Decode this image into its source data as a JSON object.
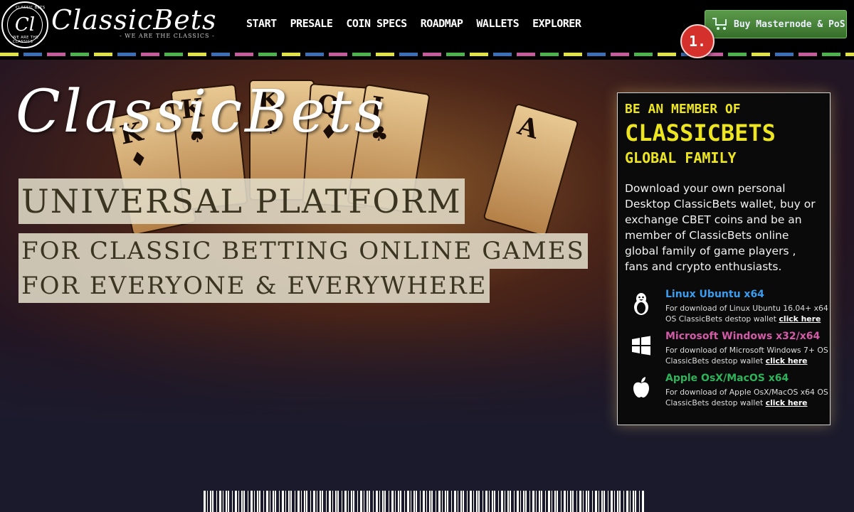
{
  "brand": {
    "seal_monogram": "Cl",
    "seal_top_text": "CLASSIC BETS",
    "seal_bottom_text": "WE ARE THE CLASSICS",
    "wordmark": "ClassicBets",
    "tagline": "- WE ARE THE CLASSICS -"
  },
  "nav": {
    "items": [
      "START",
      "PRESALE",
      "COIN SPECS",
      "ROADMAP",
      "WALLETS",
      "EXPLORER"
    ]
  },
  "header": {
    "buy_button": {
      "label": "Buy Masternode & PoS",
      "icon": "cart-icon"
    },
    "step_badge": "1."
  },
  "stripe_colors": [
    "#dfe242",
    "#3b6fb8",
    "#c45c9c",
    "#4bb24c"
  ],
  "hero": {
    "script_title": "ClassicBets",
    "headline_1": "UNIVERSAL PLATFORM",
    "headline_2": "FOR CLASSIC BETTING ONLINE GAMES",
    "headline_3": "FOR EVERYONE & EVERYWHERE",
    "cards": [
      {
        "letter": "K",
        "suit": "♦"
      },
      {
        "letter": "K",
        "suit": "♠"
      },
      {
        "letter": "K",
        "suit": "♣"
      },
      {
        "letter": "Q",
        "suit": "♦"
      },
      {
        "letter": "J",
        "suit": "♣"
      },
      {
        "letter": "A",
        "suit": ""
      }
    ]
  },
  "panel": {
    "heading_line_1": "BE AN MEMBER OF",
    "heading_line_2": "CLASSICBETS",
    "heading_line_3": "GLOBAL FAMILY",
    "description": "Download your own personal Desktop ClassicBets wallet, buy or exchange CBET coins and be an member of ClassicBets online global family of game players , fans and crypto enthusiasts.",
    "downloads": [
      {
        "title": "Linux Ubuntu x64",
        "title_color": "#3a9df0",
        "icon": "linux-tux-icon",
        "text": "For download of Linux Ubuntu 16.04+ x64 OS ClassicBets destop wallet ",
        "link": "click here"
      },
      {
        "title": "Microsoft Windows x32/x64",
        "title_color": "#d35aa6",
        "icon": "windows-icon",
        "text": "For download of Microsoft Windows 7+ OS ClassicBets destop wallet ",
        "link": "click here"
      },
      {
        "title": "Apple OsX/MacOS x64",
        "title_color": "#2fb35a",
        "icon": "apple-icon",
        "text": "For download of Apple OsX/MacOS x64 OS ClassicBets destop wallet ",
        "link": "click here"
      }
    ]
  }
}
